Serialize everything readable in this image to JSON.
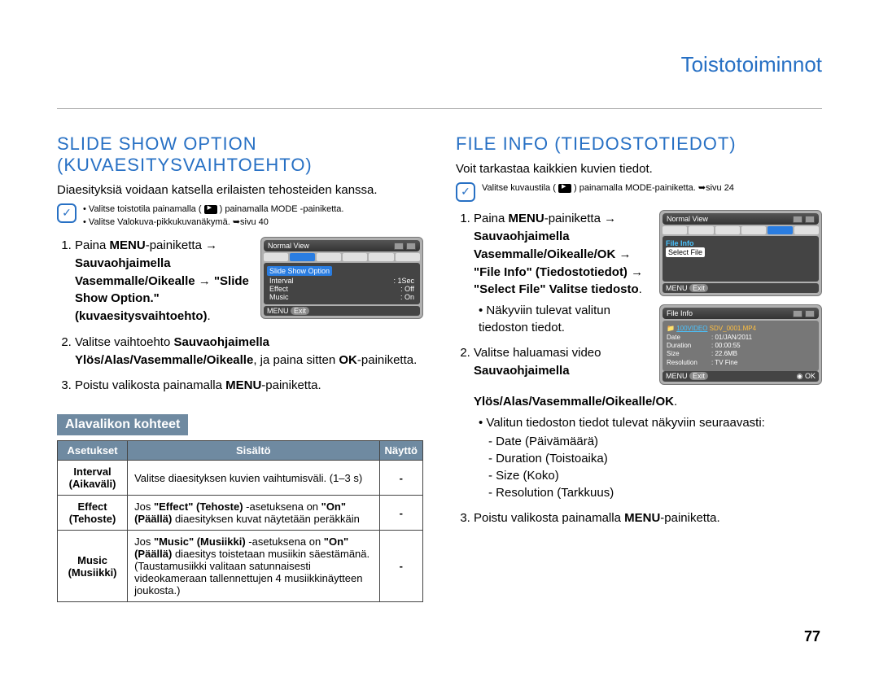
{
  "header": {
    "section": "Toistotoiminnot"
  },
  "left": {
    "title": "SLIDE SHOW OPTION (KUVAESITYSVAIHTOEHTO)",
    "intro": "Diaesityksiä voidaan katsella erilaisten tehosteiden kanssa.",
    "note1": "Valitse toistotila painamalla (",
    "note1b": ") painamalla MODE -painiketta.",
    "note2": "Valitse Valokuva-pikkukuvanäkymä. ➥sivu 40",
    "steps": {
      "s1a": "Paina ",
      "s1b": "MENU",
      "s1c": "-painiketta → ",
      "s1d": "Sauvaohjaimella Vasemmalle/Oikealle",
      "s1e": " → \"Slide Show Option.\" (kuvaesitysvaihtoehto)",
      "s1f": ".",
      "s2a": "Valitse vaihtoehto ",
      "s2b": "Sauvaohjaimella Ylös/Alas/Vasemmalle/Oikealle",
      "s2c": ", ja paina sitten ",
      "s2d": "OK",
      "s2e": "-painiketta.",
      "s3a": "Poistu valikosta painamalla ",
      "s3b": "MENU",
      "s3c": "-painiketta."
    },
    "cam": {
      "view": "Normal View",
      "hi": "Slide Show Option",
      "r_interval_k": "Interval",
      "r_interval_v": ": 1Sec",
      "r_effect_k": "Effect",
      "r_effect_v": ": Off",
      "r_music_k": "Music",
      "r_music_v": ": On",
      "menu": "MENU",
      "exit": "Exit"
    },
    "submenu_head": "Alavalikon kohteet",
    "table": {
      "h1": "Asetukset",
      "h2": "Sisältö",
      "h3": "Näyttö",
      "r1a": "Interval (Aikaväli)",
      "r1b": "Valitse diaesityksen kuvien vaihtumisväli. (1–3 s)",
      "r1c": "-",
      "r2a": "Effect (Tehoste)",
      "r2b1": "Jos ",
      "r2b2": "\"Effect\" (Tehoste)",
      "r2b3": " -asetuksena on ",
      "r2b4": "\"On\" (Päällä)",
      "r2b5": " diaesityksen kuvat näytetään peräkkäin",
      "r2c": "-",
      "r3a": "Music (Musiikki)",
      "r3b1": "Jos ",
      "r3b2": "\"Music\" (Musiikki)",
      "r3b3": " -asetuksena on ",
      "r3b4": "\"On\" (Päällä)",
      "r3b5": " diaesitys toistetaan musiikin säestämänä. (Taustamusiikki valitaan satunnaisesti videokameraan tallennettujen 4 musiikkinäytteen joukosta.)",
      "r3c": "-"
    }
  },
  "right": {
    "title": "FILE INFO (TIEDOSTOTIEDOT)",
    "intro": "Voit tarkastaa kaikkien kuvien tiedot.",
    "note": "Valitse kuvaustila (",
    "note_b": ") painamalla MODE-painiketta. ➥sivu 24",
    "steps": {
      "s1a": "Paina ",
      "s1b": "MENU",
      "s1c": "-painiketta → ",
      "s1d": "Sauvaohjaimella Vasemmalle/Oikealle/OK",
      "s1e": " → \"File Info\" (Tiedostotiedot) → \"Select File\" Valitse tiedosto",
      "s1f": ".",
      "s1_sub": "Näkyviin tulevat valitun tiedoston tiedot.",
      "s2a": "Valitse haluamasi video ",
      "s2b": "Sauvaohjaimella Ylös/Alas/Vasemmalle/Oikealle/OK",
      "s2c": ".",
      "s2_sub": "Valitun tiedoston tiedot tulevat näkyviin seuraavasti:",
      "d1": "Date (Päivämäärä)",
      "d2": "Duration (Toistoaika)",
      "d3": "Size (Koko)",
      "d4": "Resolution (Tarkkuus)",
      "s3a": "Poistu valikosta painamalla ",
      "s3b": "MENU",
      "s3c": "-painiketta."
    },
    "cam1": {
      "view": "Normal View",
      "fi": "File Info",
      "sf": "Select File",
      "menu": "MENU",
      "exit": "Exit"
    },
    "cam2": {
      "title": "File Info",
      "folder": "100VIDEO",
      "file": "SDV_0001.MP4",
      "dk": "Date",
      "dv": ": 01/JAN/2011",
      "durk": "Duration",
      "durv": ": 00:00:55",
      "sk": "Size",
      "sv": ": 22.6MB",
      "rk": "Resolution",
      "rv": ": TV Fine",
      "menu": "MENU",
      "exit": "Exit",
      "ok": "OK"
    }
  },
  "page_number": "77"
}
